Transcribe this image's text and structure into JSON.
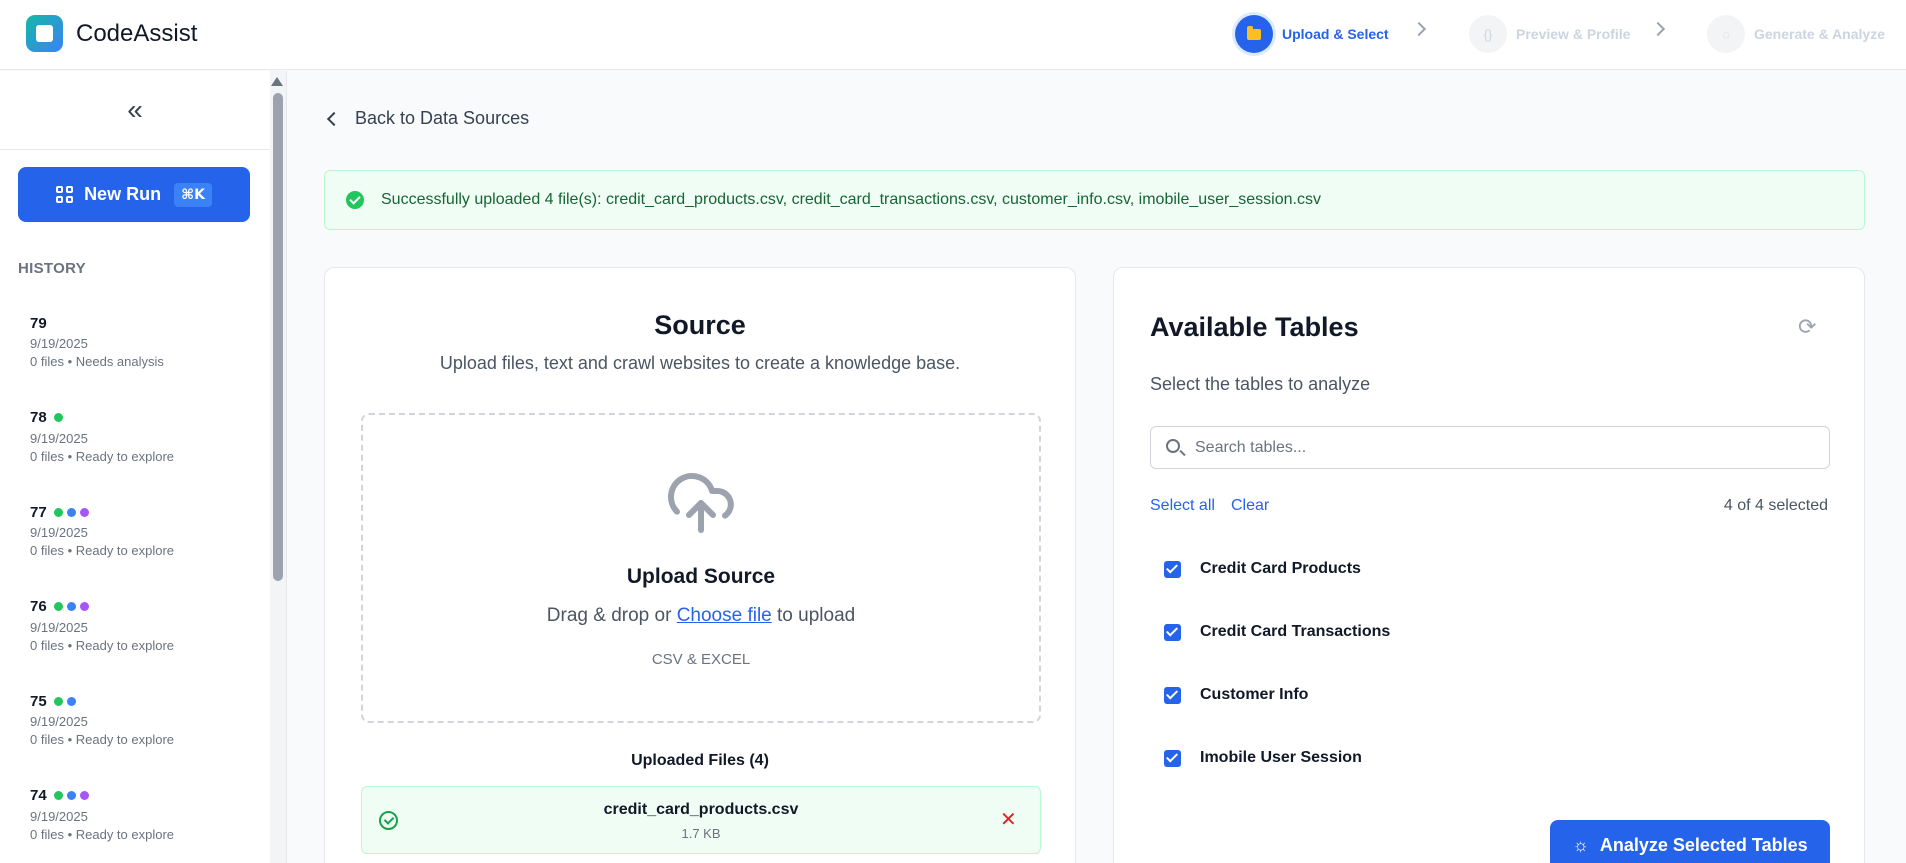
{
  "app": {
    "name": "CodeAssist"
  },
  "steps": [
    {
      "label": "Upload & Select",
      "icon": "folder-icon",
      "state": "active"
    },
    {
      "label": "Preview & Profile",
      "icon": "braces-icon",
      "state": "inactive"
    },
    {
      "label": "Generate & Analyze",
      "icon": "chat-icon",
      "state": "inactive"
    }
  ],
  "sidebar": {
    "new_run_label": "New Run",
    "new_run_shortcut": "⌘K",
    "history_label": "HISTORY",
    "history": [
      {
        "num": "79",
        "date": "9/19/2025",
        "status": "0 files • Needs analysis",
        "dots": []
      },
      {
        "num": "78",
        "date": "9/19/2025",
        "status": "0 files • Ready to explore",
        "dots": [
          "#22c55e"
        ]
      },
      {
        "num": "77",
        "date": "9/19/2025",
        "status": "0 files • Ready to explore",
        "dots": [
          "#22c55e",
          "#3b82f6",
          "#a855f7"
        ]
      },
      {
        "num": "76",
        "date": "9/19/2025",
        "status": "0 files • Ready to explore",
        "dots": [
          "#22c55e",
          "#3b82f6",
          "#a855f7"
        ]
      },
      {
        "num": "75",
        "date": "9/19/2025",
        "status": "0 files • Ready to explore",
        "dots": [
          "#22c55e",
          "#3b82f6"
        ]
      },
      {
        "num": "74",
        "date": "9/19/2025",
        "status": "0 files • Ready to explore",
        "dots": [
          "#22c55e",
          "#3b82f6",
          "#a855f7"
        ]
      }
    ]
  },
  "main": {
    "back_label": "Back to Data Sources",
    "alert_text": "Successfully uploaded 4 file(s): credit_card_products.csv, credit_card_transactions.csv, customer_info.csv, imobile_user_session.csv",
    "source": {
      "title": "Source",
      "subtitle": "Upload files, text and crawl websites to create a knowledge base.",
      "upload_title": "Upload Source",
      "drag_prefix": "Drag & drop or ",
      "choose_link": "Choose file",
      "drag_suffix": " to upload",
      "formats": "CSV & EXCEL",
      "uploaded_title": "Uploaded Files (4)",
      "files": [
        {
          "name": "credit_card_products.csv",
          "size": "1.7 KB"
        }
      ]
    },
    "tables": {
      "title": "Available Tables",
      "subtitle": "Select the tables to analyze",
      "search_placeholder": "Search tables...",
      "select_all": "Select all",
      "clear": "Clear",
      "count": "4 of 4 selected",
      "items": [
        {
          "name": "Credit Card Products",
          "checked": true
        },
        {
          "name": "Credit Card Transactions",
          "checked": true
        },
        {
          "name": "Customer Info",
          "checked": true
        },
        {
          "name": "Imobile User Session",
          "checked": true
        }
      ],
      "analyze_label": "Analyze Selected Tables"
    }
  }
}
